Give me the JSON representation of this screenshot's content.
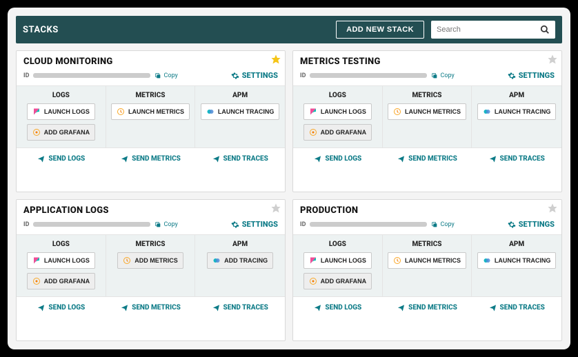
{
  "header": {
    "title": "STACKS",
    "add_button": "ADD NEW STACK",
    "search_placeholder": "Search"
  },
  "common": {
    "id_label": "ID",
    "copy": "Copy",
    "settings": "SETTINGS",
    "services": {
      "logs": "LOGS",
      "metrics": "METRICS",
      "apm": "APM"
    },
    "buttons": {
      "launch_logs": "LAUNCH LOGS",
      "add_grafana": "ADD GRAFANA",
      "launch_metrics": "LAUNCH METRICS",
      "add_metrics": "ADD METRICS",
      "launch_tracing": "LAUNCH TRACING",
      "add_tracing": "ADD TRACING"
    },
    "footer": {
      "send_logs": "SEND LOGS",
      "send_metrics": "SEND METRICS",
      "send_traces": "SEND TRACES"
    }
  },
  "stacks": [
    {
      "title": "CLOUD MONITORING",
      "starred": true,
      "metrics_mode": "launch",
      "tracing_mode": "launch"
    },
    {
      "title": "METRICS TESTING",
      "starred": false,
      "metrics_mode": "launch",
      "tracing_mode": "launch"
    },
    {
      "title": "APPLICATION LOGS",
      "starred": false,
      "metrics_mode": "add",
      "tracing_mode": "add"
    },
    {
      "title": "PRODUCTION",
      "starred": false,
      "metrics_mode": "launch",
      "tracing_mode": "launch"
    }
  ]
}
